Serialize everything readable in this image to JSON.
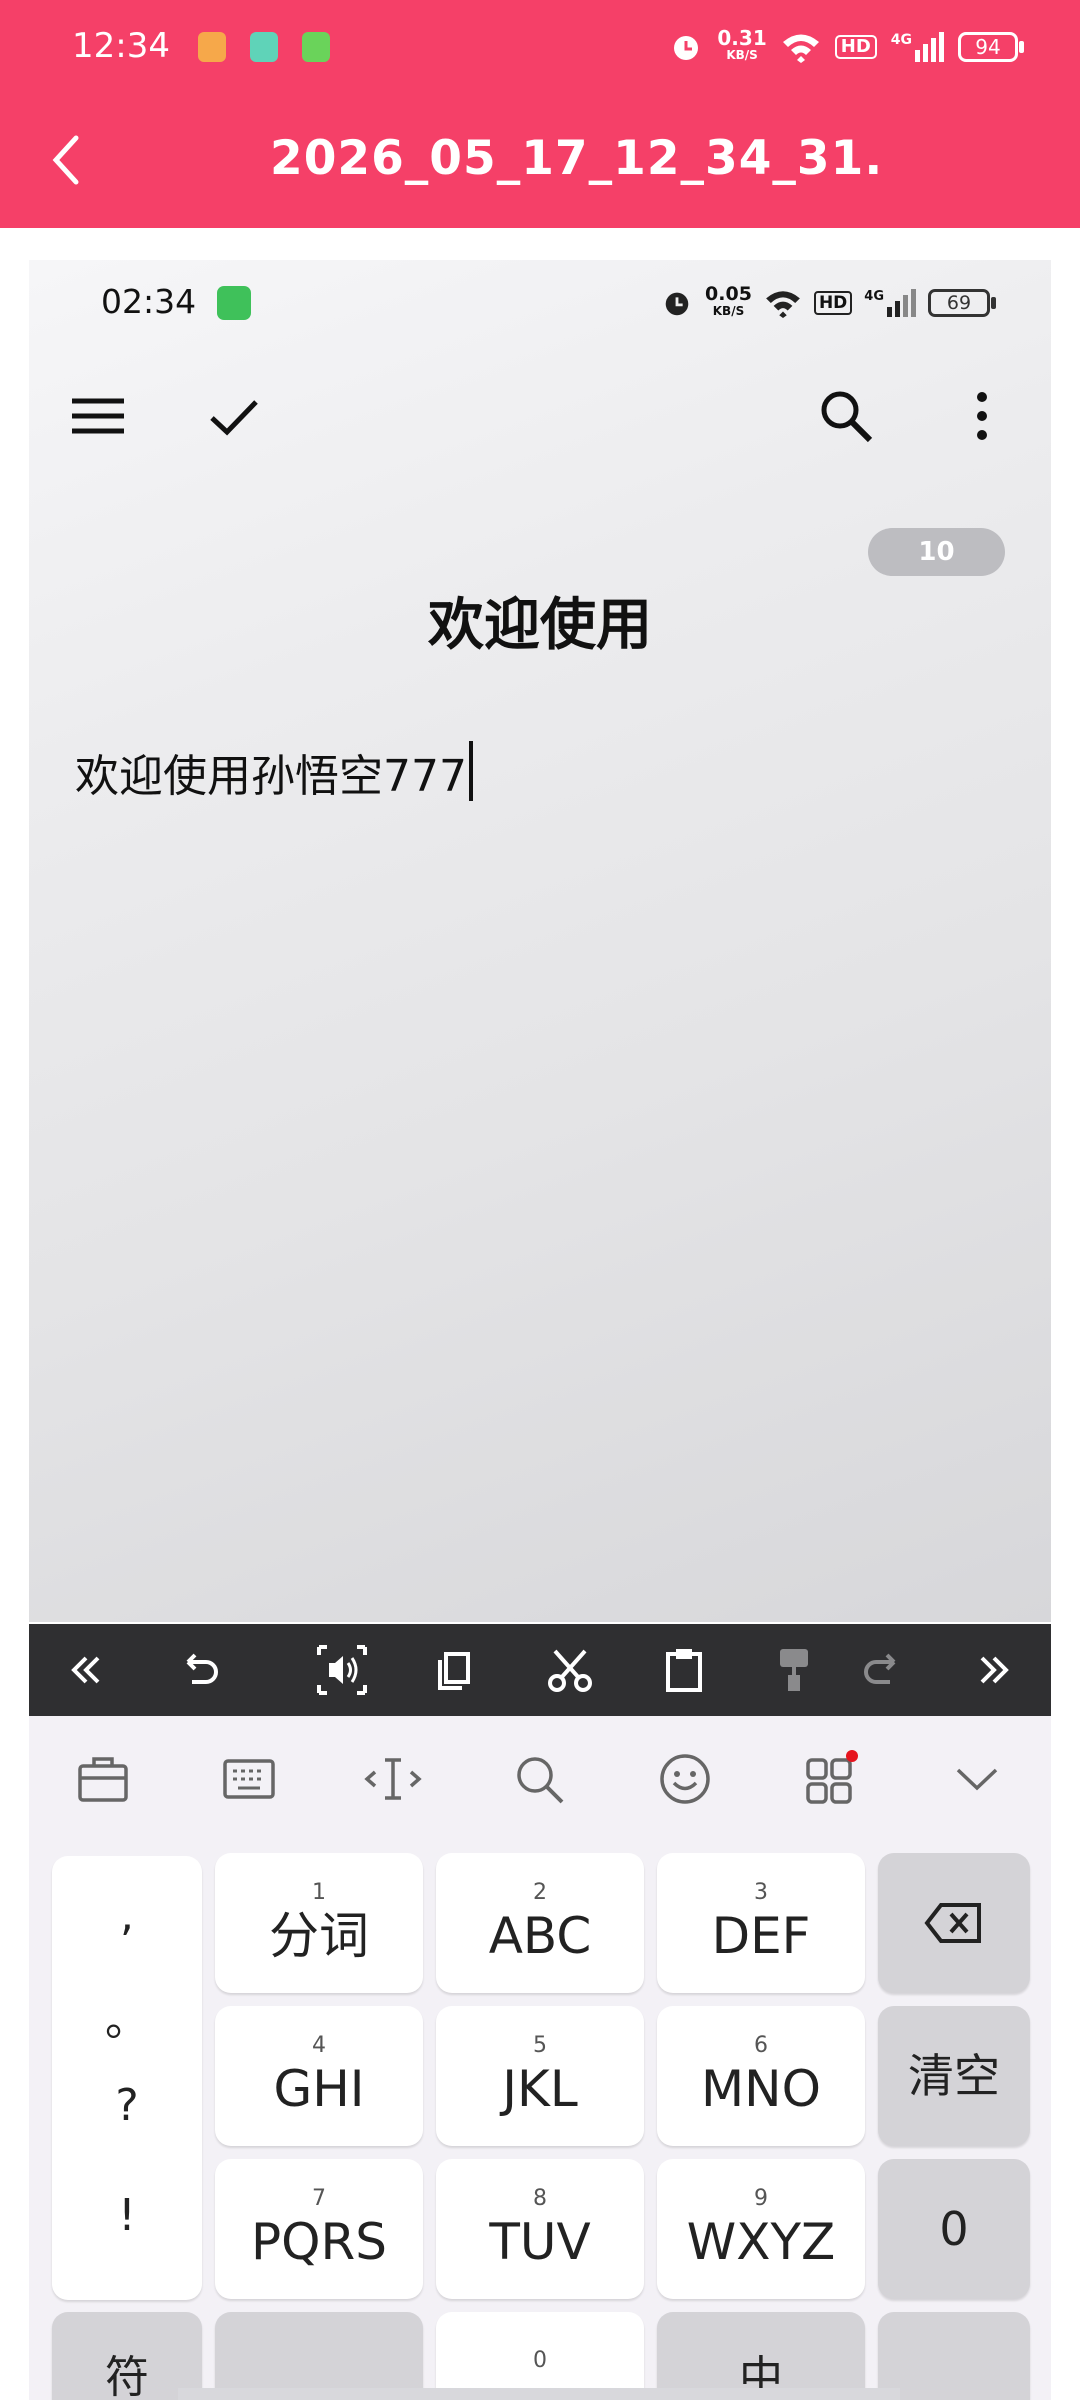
{
  "colors": {
    "accent": "#F54068"
  },
  "outer_status": {
    "time": "12:34",
    "net_speed_value": "0.31",
    "net_speed_unit": "KB/S",
    "network": "4G",
    "hd": "HD",
    "battery": "94"
  },
  "outer_header": {
    "title": "2026_05_17_12_34_31."
  },
  "inner_status": {
    "time": "02:34",
    "net_speed_value": "0.05",
    "net_speed_unit": "KB/S",
    "network": "4G",
    "hd": "HD",
    "battery": "69"
  },
  "note": {
    "count_badge": "10",
    "title": "欢迎使用",
    "body": "欢迎使用孙悟空777"
  },
  "keyboard": {
    "punct": [
      ",",
      "。",
      "?",
      "!"
    ],
    "keys": [
      {
        "num": "1",
        "label": "分词"
      },
      {
        "num": "2",
        "label": "ABC"
      },
      {
        "num": "3",
        "label": "DEF"
      },
      {
        "num": "4",
        "label": "GHI"
      },
      {
        "num": "5",
        "label": "JKL"
      },
      {
        "num": "6",
        "label": "MNO"
      },
      {
        "num": "7",
        "label": "PQRS"
      },
      {
        "num": "8",
        "label": "TUV"
      },
      {
        "num": "9",
        "label": "WXYZ"
      }
    ],
    "clear": "清空",
    "zero": "0",
    "bottom_row": [
      "符",
      "",
      "0",
      "中",
      ""
    ]
  }
}
